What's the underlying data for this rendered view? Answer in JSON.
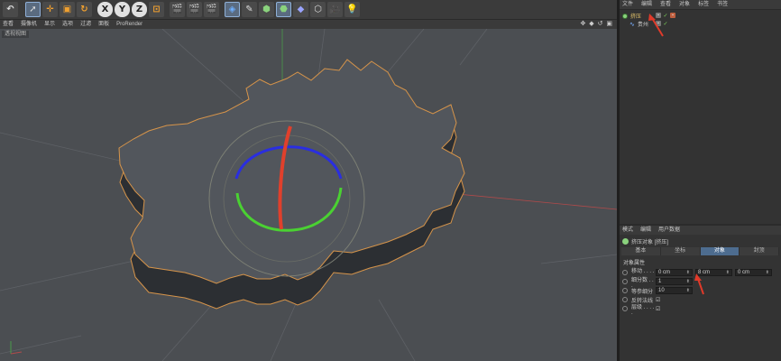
{
  "viewport_menu": [
    "查看",
    "摄像机",
    "显示",
    "选项",
    "过滤",
    "面板",
    "ProRender"
  ],
  "viewport_label": "透视视图",
  "nav_icons": "✥ ◆ ↺ ▣",
  "toolbar": {
    "axis_x": "X",
    "axis_y": "Y",
    "axis_z": "Z"
  },
  "object_manager": {
    "menu": [
      "文件",
      "编辑",
      "查看",
      "对象",
      "标签",
      "书签"
    ],
    "objects": [
      {
        "label": "挤压"
      },
      {
        "label": "贵州"
      }
    ]
  },
  "attribute_manager": {
    "menu": [
      "模式",
      "编辑",
      "用户数据"
    ],
    "object_title": "挤压对象 [挤压]",
    "tabs": [
      "基本",
      "坐标",
      "对象",
      "封顶"
    ],
    "active_tab": "对象",
    "section": "对象属性",
    "params": {
      "move": {
        "label": "移动 . . . . .",
        "x": "0 cm",
        "y": "8 cm",
        "z": "0 cm"
      },
      "subdivision": {
        "label": "细分数 . . .",
        "value": "1"
      },
      "iso": {
        "label": "等参细分",
        "value": "10"
      },
      "flip_normals": {
        "label": "反转法线"
      },
      "hierarchy": {
        "label": "层级 . . . . ."
      }
    }
  },
  "colors": {
    "viewport_bg": "#4b4e52",
    "mesh_face": "#52565c",
    "mesh_side": "#2c2f33",
    "outline": "#d6944a",
    "rotate_red": "#e0402c",
    "rotate_green": "#4ad132",
    "rotate_blue": "#2a2ee0",
    "annotation": "#e03a2a",
    "active_tab": "#4d6c8f"
  }
}
